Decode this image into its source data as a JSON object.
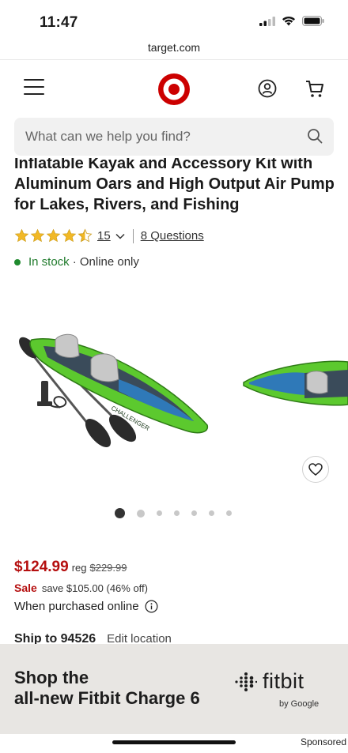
{
  "status_bar": {
    "time": "11:47",
    "icons": [
      "cellular-signal-icon",
      "wifi-icon",
      "battery-icon"
    ]
  },
  "browser": {
    "url": "target.com"
  },
  "header": {
    "icons": [
      "menu-icon",
      "target-logo",
      "account-icon",
      "cart-icon"
    ]
  },
  "search": {
    "placeholder": "What can we help you find?"
  },
  "product": {
    "title": "Inflatable Kayak and Accessory Kit with Aluminum Oars and High Output Air Pump for Lakes, Rivers, and Fishing",
    "rating": 4.5,
    "rating_max": 5,
    "review_count": "15",
    "questions": "8 Questions",
    "stock_status": "In stock",
    "stock_extra": "· Online only",
    "price": "$124.99",
    "reg_label": "reg",
    "reg_price": "$229.99",
    "sale_label": "Sale",
    "save_text": "save $105.00 (46% off)",
    "purchase_note": "When purchased online",
    "ship_to": "Ship to 94526",
    "edit_location": "Edit location",
    "kayak_print": "CHALLENGER",
    "image_count": 7,
    "active_image": 1
  },
  "ad": {
    "line1": "Shop the",
    "line2": "all-new Fitbit Charge 6",
    "brand": "fitbit",
    "brand_sub": "by Google",
    "sponsored": "Sponsored"
  },
  "colors": {
    "target_red": "#cc0000",
    "price_red": "#b50f0f",
    "stock_green": "#1f8a2e",
    "star_gold": "#f1b826",
    "ad_bg": "#e8e6e3"
  }
}
